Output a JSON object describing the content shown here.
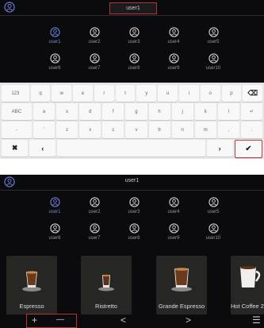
{
  "screen1": {
    "user_field_value": "user1",
    "users": [
      {
        "label": "user1",
        "selected": true
      },
      {
        "label": "user2"
      },
      {
        "label": "user3"
      },
      {
        "label": "user4"
      },
      {
        "label": "user5"
      },
      {
        "label": "user6"
      },
      {
        "label": "user7"
      },
      {
        "label": "user8"
      },
      {
        "label": "user9"
      },
      {
        "label": "user10"
      }
    ],
    "keyboard": {
      "row1": [
        "123",
        "q",
        "w",
        "e",
        "r",
        "t",
        "y",
        "u",
        "i",
        "o",
        "p",
        "⌫"
      ],
      "row2": [
        "ABC",
        "a",
        "s",
        "d",
        "f",
        "g",
        "h",
        "j",
        "k",
        "l",
        "↵"
      ],
      "row3": [
        "-",
        "'",
        "z",
        "x",
        "c",
        "v",
        "b",
        "n",
        "m",
        ",",
        "."
      ],
      "row4": [
        "✖",
        "‹",
        "",
        "›",
        "✔"
      ]
    }
  },
  "screen2": {
    "title": "user1",
    "users": [
      {
        "label": "user1",
        "selected": true
      },
      {
        "label": "user2"
      },
      {
        "label": "user3"
      },
      {
        "label": "user4"
      },
      {
        "label": "user5"
      },
      {
        "label": "user6"
      },
      {
        "label": "user7"
      },
      {
        "label": "user8"
      },
      {
        "label": "user9"
      },
      {
        "label": "user10"
      }
    ],
    "products": [
      "Espresso",
      "Ristretto",
      "Grande Espresso",
      "Hot Coffee 2"
    ],
    "bottom": {
      "plus": "+",
      "minus": "—",
      "prev": "<",
      "next": ">",
      "menu": "☰"
    }
  },
  "colors": {
    "accent_red": "#b23434",
    "selected_blue": "#7a88d0",
    "panel_bg": "#0b0b0d"
  },
  "icons": {
    "avatar": "user-circle-icon"
  }
}
